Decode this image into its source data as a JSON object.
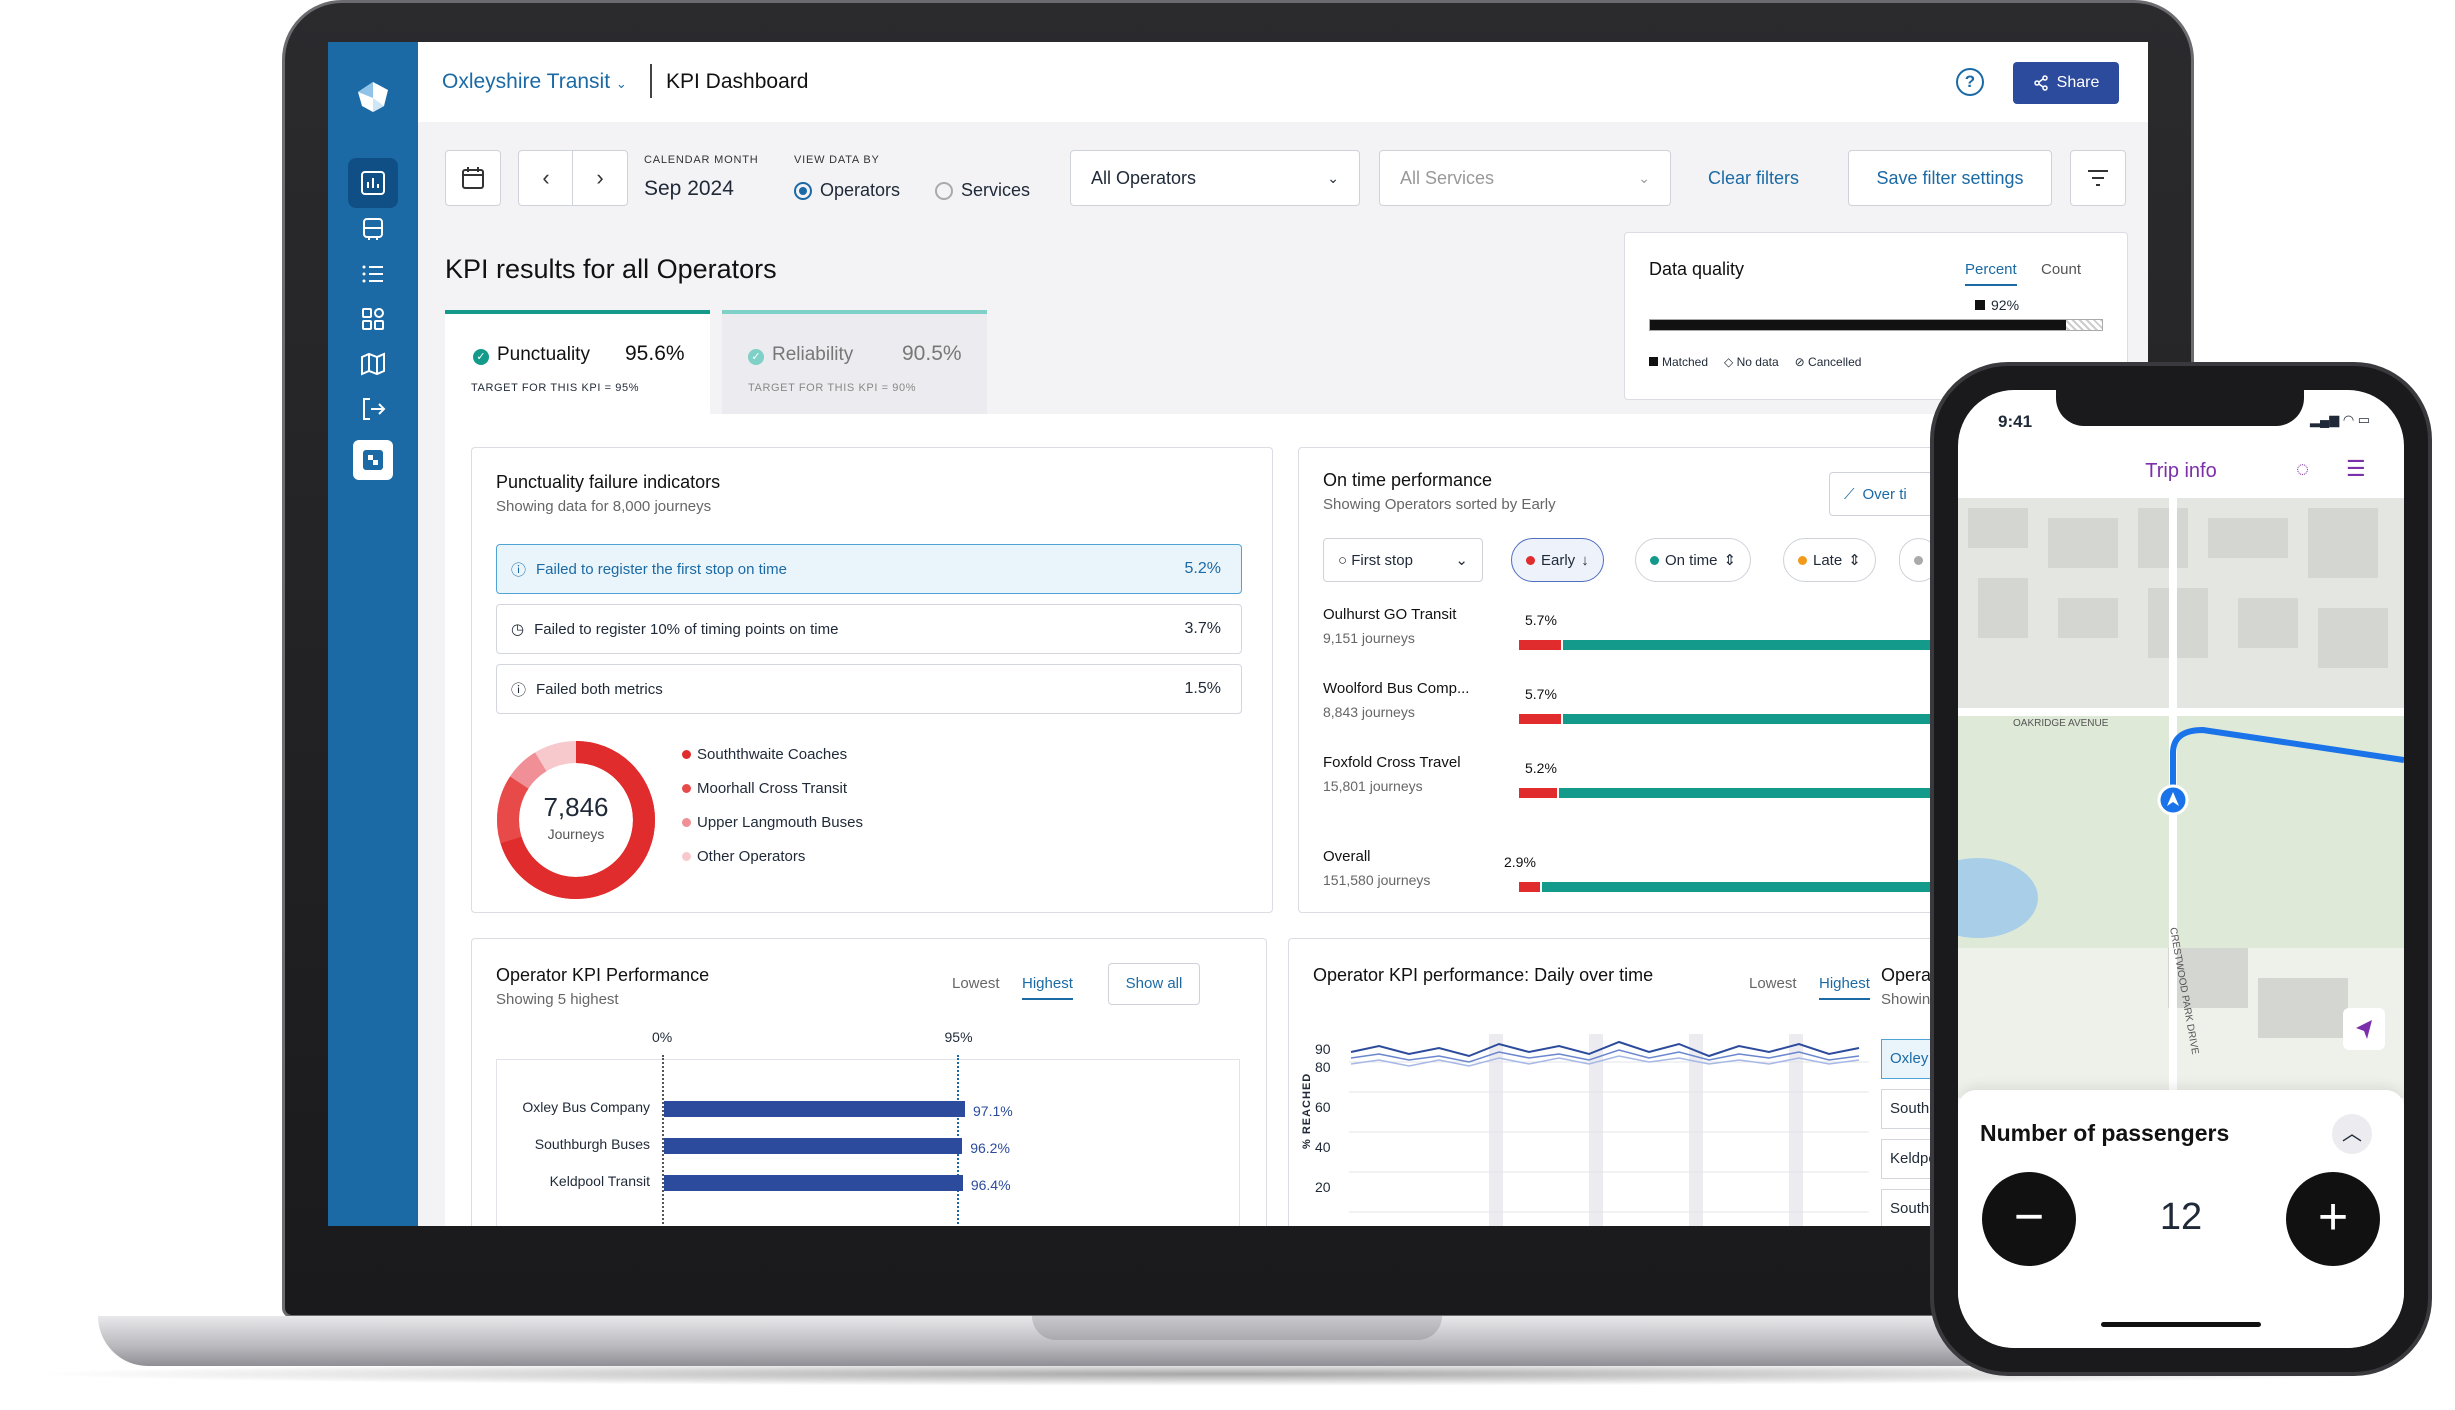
{
  "header": {
    "org": "Oxleyshire Transit",
    "title": "KPI Dashboard",
    "share": "Share"
  },
  "filters": {
    "cal_label": "CALENDAR MONTH",
    "cal_value": "Sep 2024",
    "view_label": "VIEW DATA BY",
    "view_opt1": "Operators",
    "view_opt2": "Services",
    "operators": "All Operators",
    "services": "All Services",
    "clear": "Clear filters",
    "save": "Save filter settings"
  },
  "kpi": {
    "heading": "KPI results for all Operators",
    "tab1": {
      "label": "Punctuality",
      "value": "95.6%",
      "target": "TARGET FOR THIS KPI = 95%"
    },
    "tab2": {
      "label": "Reliability",
      "value": "90.5%",
      "target": "TARGET FOR THIS KPI = 90%"
    }
  },
  "dq": {
    "title": "Data quality",
    "percent": "Percent",
    "count": "Count",
    "value": "92%",
    "matched_fraction": 0.92,
    "legend": [
      "Matched",
      "No data",
      "Cancelled"
    ]
  },
  "pfi": {
    "title": "Punctuality failure indicators",
    "sub": "Showing data for 8,000 journeys",
    "rows": [
      {
        "label": "Failed to register the first stop on time",
        "value": "5.2%"
      },
      {
        "label": "Failed to register 10% of timing points on time",
        "value": "3.7%"
      },
      {
        "label": "Failed both metrics",
        "value": "1.5%"
      }
    ],
    "donut_value": "7,846",
    "donut_label": "Journeys",
    "legend": [
      "Souththwaite Coaches",
      "Moorhall Cross Transit",
      "Upper Langmouth Buses",
      "Other Operators"
    ],
    "legend_colors": [
      "#e02c2c",
      "#e84a4a",
      "#f08f96",
      "#f7c9cc"
    ]
  },
  "otp": {
    "title": "On time performance",
    "sub": "Showing Operators sorted by Early",
    "btn": "Over ti",
    "filter": "First stop",
    "pill_early": "Early",
    "pill_on": "On time",
    "pill_late": "Late",
    "rows": [
      {
        "name": "Oulhurst GO Transit",
        "journeys": "9,151 journeys",
        "early": "5.7%",
        "early_val": 5.7
      },
      {
        "name": "Woolford Bus Comp...",
        "journeys": "8,843 journeys",
        "early": "5.7%",
        "early_val": 5.7
      },
      {
        "name": "Foxfold Cross Travel",
        "journeys": "15,801 journeys",
        "early": "5.2%",
        "early_val": 5.2
      },
      {
        "name": "Overall",
        "journeys": "151,580 journeys",
        "early": "2.9%",
        "early_val": 2.9
      }
    ]
  },
  "okp": {
    "title": "Operator KPI Performance",
    "sub": "Showing 5 highest",
    "lowest": "Lowest",
    "highest": "Highest",
    "show_all": "Show all",
    "axis_left": "0%",
    "axis_target": "95%",
    "chart_data": {
      "type": "bar",
      "categories": [
        "Oxley Bus Company",
        "Southburgh Buses",
        "Keldpool Transit"
      ],
      "values": [
        97.1,
        96.2,
        96.4
      ],
      "labels": [
        "97.1%",
        "96.2%",
        "96.4%"
      ],
      "target": 95,
      "xlim": [
        0,
        100
      ]
    }
  },
  "daily": {
    "title": "Operator KPI performance: Daily over time",
    "lowest": "Lowest",
    "highest": "Highest",
    "ylabel": "% REACHED",
    "yticks": [
      "90",
      "80",
      "60",
      "40",
      "20"
    ],
    "side_title": "Operato",
    "side_sub": "Showing",
    "side_items": [
      "Oxley B",
      "Southb",
      "Keldpo",
      "Southt"
    ]
  },
  "phone": {
    "time": "9:41",
    "title": "Trip info",
    "street1": "OAKRIDGE AVENUE",
    "street2": "CRESTWOOD PARK DRIVE",
    "passengers_label": "Number of passengers",
    "passengers": "12"
  },
  "colors": {
    "brand": "#1b6aa5",
    "navy": "#2c4b9c",
    "red": "#e02c2c",
    "teal": "#139a8a",
    "purple": "#7b2fa8"
  }
}
